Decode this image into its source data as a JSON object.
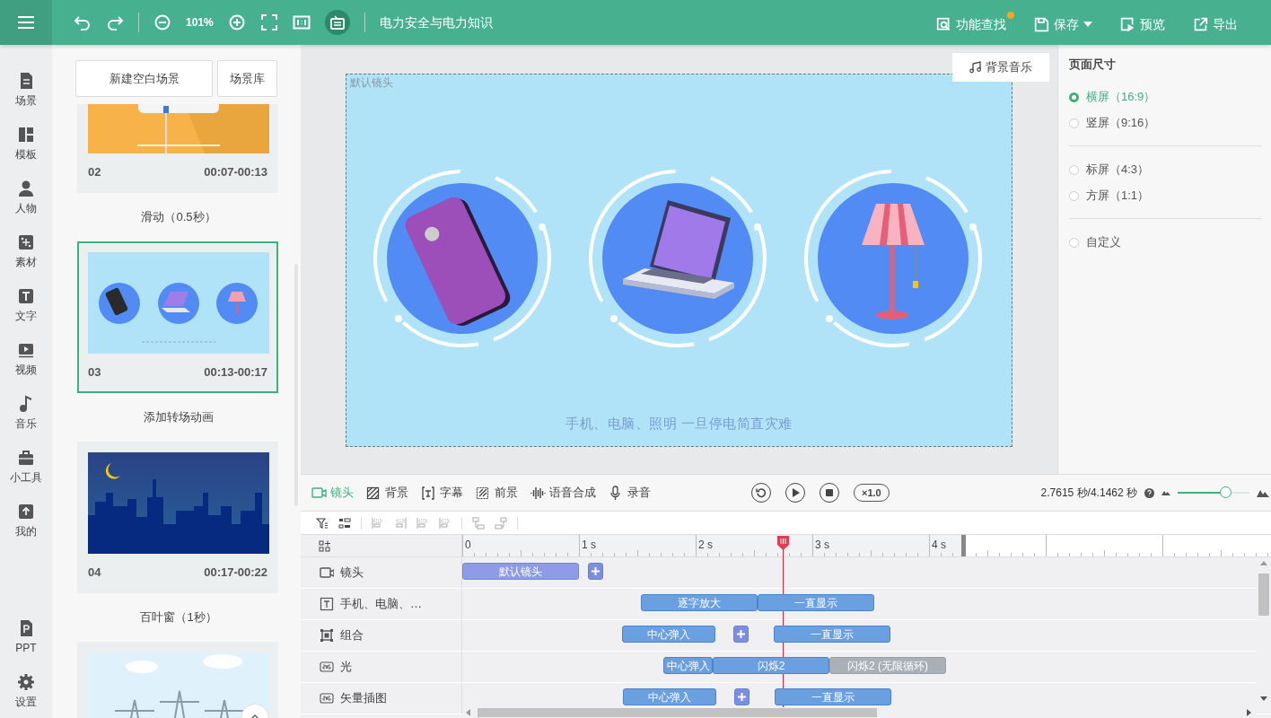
{
  "topbar": {
    "zoom": "101%",
    "title": "电力安全与电力知识",
    "actions": [
      {
        "label": "功能查找",
        "kind": "search",
        "notice": true,
        "dropdown": false
      },
      {
        "label": "保存",
        "kind": "save",
        "notice": false,
        "dropdown": true
      },
      {
        "label": "预览",
        "kind": "preview",
        "notice": false,
        "dropdown": false
      },
      {
        "label": "导出",
        "kind": "export",
        "notice": false,
        "dropdown": false
      }
    ]
  },
  "nav": {
    "items": [
      {
        "label": "场景",
        "kind": "scene"
      },
      {
        "label": "模板",
        "kind": "template"
      },
      {
        "label": "人物",
        "kind": "person"
      },
      {
        "label": "素材",
        "kind": "material"
      },
      {
        "label": "文字",
        "kind": "text"
      },
      {
        "label": "视频",
        "kind": "video"
      },
      {
        "label": "音乐",
        "kind": "music"
      },
      {
        "label": "小工具",
        "kind": "tools"
      },
      {
        "label": "我的",
        "kind": "mine"
      }
    ],
    "bottom_items": [
      {
        "label": "PPT",
        "kind": "ppt"
      },
      {
        "label": "设置",
        "kind": "settings"
      }
    ]
  },
  "scene_panel": {
    "buttons": [
      "新建空白场景",
      "场景库"
    ],
    "scenes": [
      {
        "number": "02",
        "time": "00:07-00:13",
        "selected": false,
        "transition": "滑动（0.5秒）"
      },
      {
        "number": "03",
        "time": "00:13-00:17",
        "selected": true,
        "transition": "添加转场动画"
      },
      {
        "number": "04",
        "time": "00:17-00:22",
        "selected": false,
        "transition": "百叶窗（1秒）"
      },
      {
        "selected": false
      }
    ]
  },
  "canvas": {
    "shot_label": "默认镜头",
    "music_button": "背景音乐",
    "caption": "手机、电脑、照明 一旦停电简直灾难"
  },
  "page_size": {
    "title": "页面尺寸",
    "groups": [
      {
        "options": [
          {
            "label": "横屏（16:9）",
            "selected": true
          },
          {
            "label": "竖屏（9:16）",
            "selected": false
          }
        ]
      },
      {
        "options": [
          {
            "label": "标屏（4:3）",
            "selected": false
          },
          {
            "label": "方屏（1:1）",
            "selected": false
          }
        ]
      },
      {
        "options": [
          {
            "label": "自定义",
            "selected": false
          }
        ]
      }
    ]
  },
  "timeline": {
    "tabs": [
      {
        "label": "镜头",
        "kind": "camera",
        "selected": true
      },
      {
        "label": "背景",
        "kind": "background",
        "selected": false
      },
      {
        "label": "字幕",
        "kind": "subtitle",
        "selected": false
      },
      {
        "label": "前景",
        "kind": "foreground",
        "selected": false
      },
      {
        "label": "语音合成",
        "kind": "voice",
        "selected": false
      },
      {
        "label": "录音",
        "kind": "mic",
        "selected": false
      }
    ],
    "speed": "×1.0",
    "time": "2.7615 秒/4.1462 秒",
    "zoom": {
      "level": 0.66
    },
    "ruler": [
      "0",
      "1 s",
      "2 s",
      "3 s",
      "4 s"
    ],
    "tracks": [
      {
        "label": "镜头",
        "kind": "camera",
        "clips": [
          {
            "kind": "camera",
            "label": "默认镜头"
          },
          {
            "kind": "add"
          }
        ]
      },
      {
        "label": "手机、电脑、…",
        "kind": "text",
        "clips": [
          {
            "kind": "effect",
            "label": "逐字放大"
          },
          {
            "kind": "effect",
            "label": "一直显示"
          }
        ]
      },
      {
        "label": "组合",
        "kind": "group",
        "clips": [
          {
            "kind": "effect",
            "label": "中心弹入"
          },
          {
            "kind": "add"
          },
          {
            "kind": "effect",
            "label": "一直显示"
          }
        ]
      },
      {
        "label": "光",
        "kind": "svg",
        "clips": [
          {
            "kind": "effect",
            "label": "中心弹入"
          },
          {
            "kind": "effect",
            "label": "闪烁2"
          },
          {
            "kind": "loop",
            "label": "闪烁2 (无限循环)"
          }
        ]
      },
      {
        "label": "矢量插图",
        "kind": "svg",
        "clips": [
          {
            "kind": "effect",
            "label": "中心弹入"
          },
          {
            "kind": "add"
          },
          {
            "kind": "effect",
            "label": "一直显示"
          }
        ]
      }
    ]
  }
}
